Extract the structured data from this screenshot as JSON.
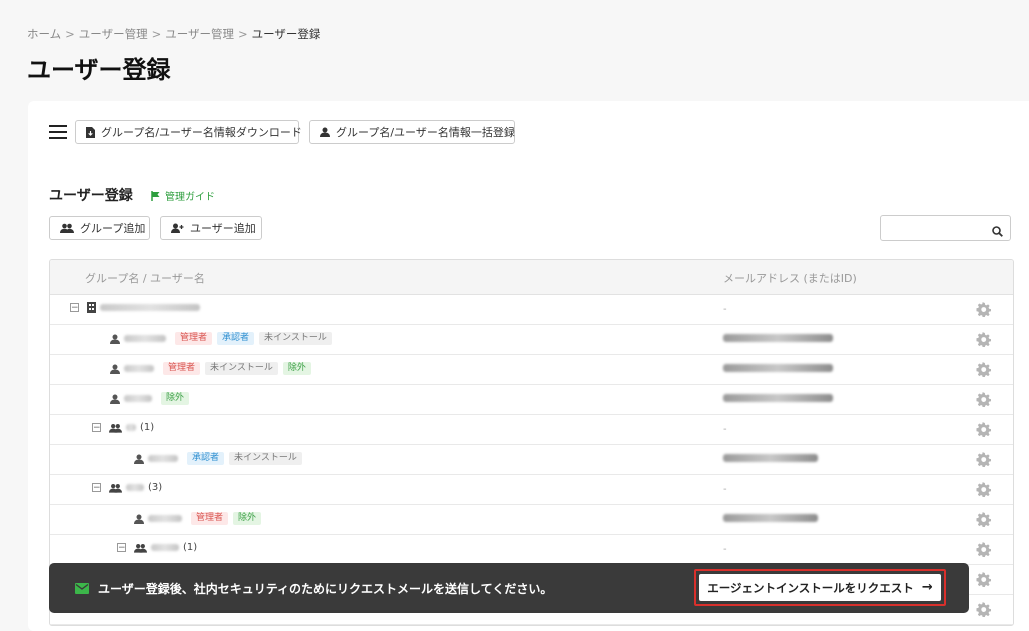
{
  "breadcrumb": {
    "items": [
      "ホーム",
      "ユーザー管理",
      "ユーザー管理"
    ],
    "current": "ユーザー登録",
    "separator": ">"
  },
  "page_title": "ユーザー登録",
  "toolbar": {
    "download_label": "グループ名/ユーザー名情報ダウンロード",
    "bulk_register_label": "グループ名/ユーザー名情報一括登録"
  },
  "section": {
    "title": "ユーザー登録",
    "guide_label": "管理ガイド",
    "add_group_label": "グループ追加",
    "add_user_label": "ユーザー追加"
  },
  "search": {
    "placeholder": "",
    "value": ""
  },
  "table": {
    "col_name": "グループ名 / ユーザー名",
    "col_email": "メールアドレス (またはID)",
    "rows": [
      {
        "type": "org",
        "count": "",
        "badges": [],
        "email": "-"
      },
      {
        "type": "user",
        "count": "",
        "badges": [
          "管理者",
          "承認者",
          "未インストール"
        ],
        "email": ""
      },
      {
        "type": "user",
        "count": "",
        "badges": [
          "管理者",
          "未インストール",
          "除外"
        ],
        "email": ""
      },
      {
        "type": "user",
        "count": "",
        "badges": [
          "除外"
        ],
        "email": ""
      },
      {
        "type": "group",
        "count": "(1)",
        "badges": [],
        "email": "-"
      },
      {
        "type": "user",
        "count": "",
        "badges": [
          "承認者",
          "未インストール"
        ],
        "email": ""
      },
      {
        "type": "group",
        "count": "(3)",
        "badges": [],
        "email": "-"
      },
      {
        "type": "user",
        "count": "",
        "badges": [
          "管理者",
          "除外"
        ],
        "email": ""
      },
      {
        "type": "group",
        "count": "(1)",
        "badges": [],
        "email": "-"
      },
      {
        "type": "user",
        "count": "",
        "badges": [],
        "email": ""
      },
      {
        "type": "user",
        "count": "",
        "badges": [],
        "email": ""
      }
    ]
  },
  "toast": {
    "message": "ユーザー登録後、社内セキュリティのためにリクエストメールを送信してください。",
    "button_label": "エージェントインストールをリクエスト",
    "button_arrow": "→"
  },
  "colors": {
    "admin": "#d9534f",
    "approver": "#2f8fd0",
    "not_installed": "#777777",
    "excluded": "#3ea148",
    "guide": "#2e9e3e",
    "toast_bg": "#3a3a3a",
    "cta_border": "#d9302c"
  },
  "icons": [
    "menu-icon",
    "file-download-icon",
    "user-icon",
    "flag-icon",
    "add-group-icon",
    "add-user-icon",
    "search-icon",
    "building-icon",
    "group-icon",
    "gear-icon",
    "mail-icon",
    "arrow-right-icon"
  ]
}
